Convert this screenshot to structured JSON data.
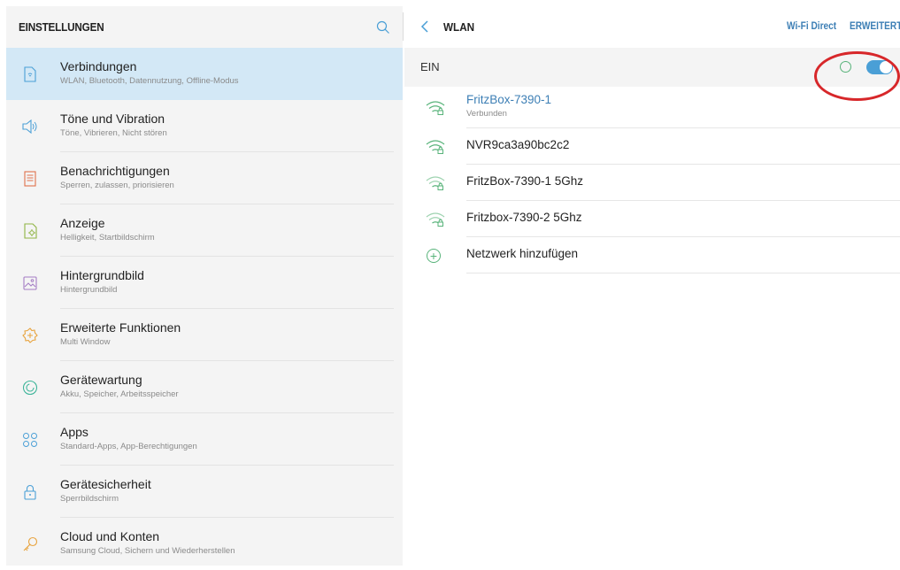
{
  "sidebar": {
    "title": "EINSTELLUNGEN",
    "items": [
      {
        "label": "Verbindungen",
        "sub": "WLAN, Bluetooth, Datennutzung, Offline-Modus",
        "icon": "connections-icon",
        "active": true
      },
      {
        "label": "Töne und Vibration",
        "sub": "Töne, Vibrieren, Nicht stören",
        "icon": "sound-icon"
      },
      {
        "label": "Benachrichtigungen",
        "sub": "Sperren, zulassen, priorisieren",
        "icon": "notifications-icon"
      },
      {
        "label": "Anzeige",
        "sub": "Helligkeit, Startbildschirm",
        "icon": "display-icon"
      },
      {
        "label": "Hintergrundbild",
        "sub": "Hintergrundbild",
        "icon": "wallpaper-icon"
      },
      {
        "label": "Erweiterte Funktionen",
        "sub": "Multi Window",
        "icon": "advanced-features-icon"
      },
      {
        "label": "Gerätewartung",
        "sub": "Akku, Speicher, Arbeitsspeicher",
        "icon": "device-maintenance-icon"
      },
      {
        "label": "Apps",
        "sub": "Standard-Apps, App-Berechtigungen",
        "icon": "apps-icon"
      },
      {
        "label": "Gerätesicherheit",
        "sub": "Sperrbildschirm",
        "icon": "lock-icon"
      },
      {
        "label": "Cloud und Konten",
        "sub": "Samsung Cloud, Sichern und Wiederherstellen",
        "icon": "key-icon"
      }
    ]
  },
  "wlan": {
    "title": "WLAN",
    "wifi_direct": "Wi-Fi Direct",
    "advanced": "ERWEITERT",
    "status_label": "EIN",
    "enabled": true,
    "networks": [
      {
        "ssid": "FritzBox-7390-1",
        "status": "Verbunden",
        "connected": true
      },
      {
        "ssid": "NVR9ca3a90bc2c2"
      },
      {
        "ssid": "FritzBox-7390-1 5Ghz"
      },
      {
        "ssid": "Fritzbox-7390-2 5Ghz"
      }
    ],
    "add_network": "Netzwerk hinzufügen"
  },
  "colors": {
    "accent": "#3d7fb5",
    "toggle": "#4a9fd6",
    "active_bg": "#d3e8f6",
    "green": "#58b37a",
    "highlight_ellipse": "#d7272a"
  }
}
